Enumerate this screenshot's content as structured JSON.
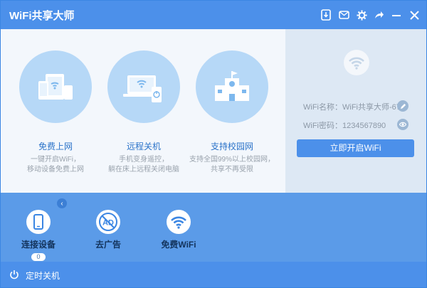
{
  "app": {
    "title": "WiFi共享大师"
  },
  "titlebar": {
    "icons": [
      "download-icon",
      "mail-icon",
      "gear-icon",
      "share-icon",
      "minimize-icon",
      "close-icon"
    ]
  },
  "features": [
    {
      "icon": "devices-icon",
      "title": "免费上网",
      "line1": "一键开启WiFi，",
      "line2": "移动设备免费上网"
    },
    {
      "icon": "remote-shutdown-icon",
      "title": "远程关机",
      "line1": "手机变身遥控，",
      "line2": "躺在床上远程关闭电脑"
    },
    {
      "icon": "campus-icon",
      "title": "支持校园网",
      "line1": "支持全国99%以上校园网，",
      "line2": "共享不再受限"
    }
  ],
  "wifi_info": {
    "name_label": "WiFi名称：",
    "name_value": "WiFi共享大师-67",
    "pass_label": "WiFi密码：",
    "pass_value": "1234567890",
    "start_button": "立即开启WiFi"
  },
  "tools": [
    {
      "icon": "phone-icon",
      "label": "连接设备",
      "count": "0"
    },
    {
      "icon": "ad-block-icon",
      "label": "去广告"
    },
    {
      "icon": "wifi-icon",
      "label": "免费WiFi"
    }
  ],
  "status": {
    "label": "定时关机"
  },
  "colors": {
    "primary": "#4c90ea",
    "circle": "#b6d8f7",
    "bottom": "#5b9be8"
  }
}
